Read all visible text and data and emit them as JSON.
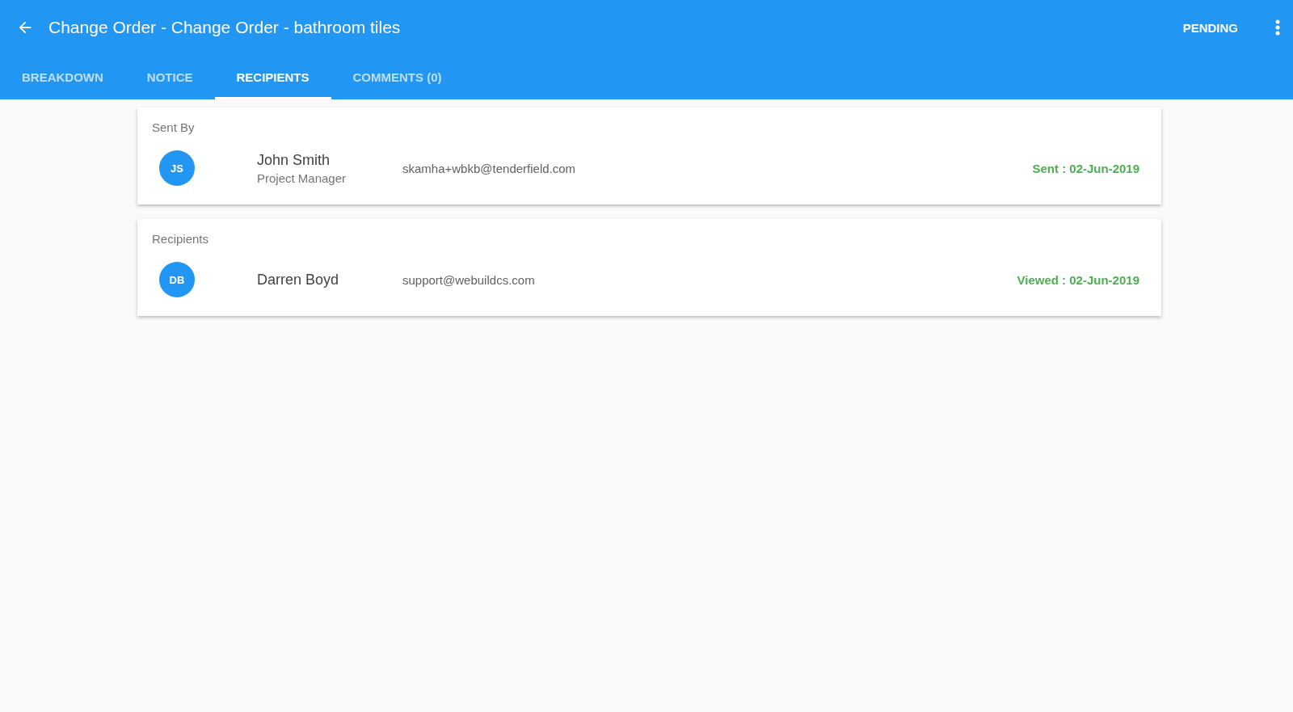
{
  "header": {
    "title": "Change Order - Change Order - bathroom tiles",
    "status": "PENDING"
  },
  "tabs": [
    {
      "label": "BREAKDOWN",
      "selected": false
    },
    {
      "label": "NOTICE",
      "selected": false
    },
    {
      "label": "RECIPIENTS",
      "selected": true
    },
    {
      "label": "COMMENTS (0)",
      "selected": false
    }
  ],
  "sections": [
    {
      "heading": "Sent By",
      "people": [
        {
          "initials": "JS",
          "name": "John Smith",
          "role": "Project Manager",
          "email": "skamha+wbkb@tenderfield.com",
          "status": "Sent : 02-Jun-2019"
        }
      ]
    },
    {
      "heading": "Recipients",
      "people": [
        {
          "initials": "DB",
          "name": "Darren Boyd",
          "email": "support@webuildcs.com",
          "status": "Viewed : 02-Jun-2019"
        }
      ]
    }
  ]
}
